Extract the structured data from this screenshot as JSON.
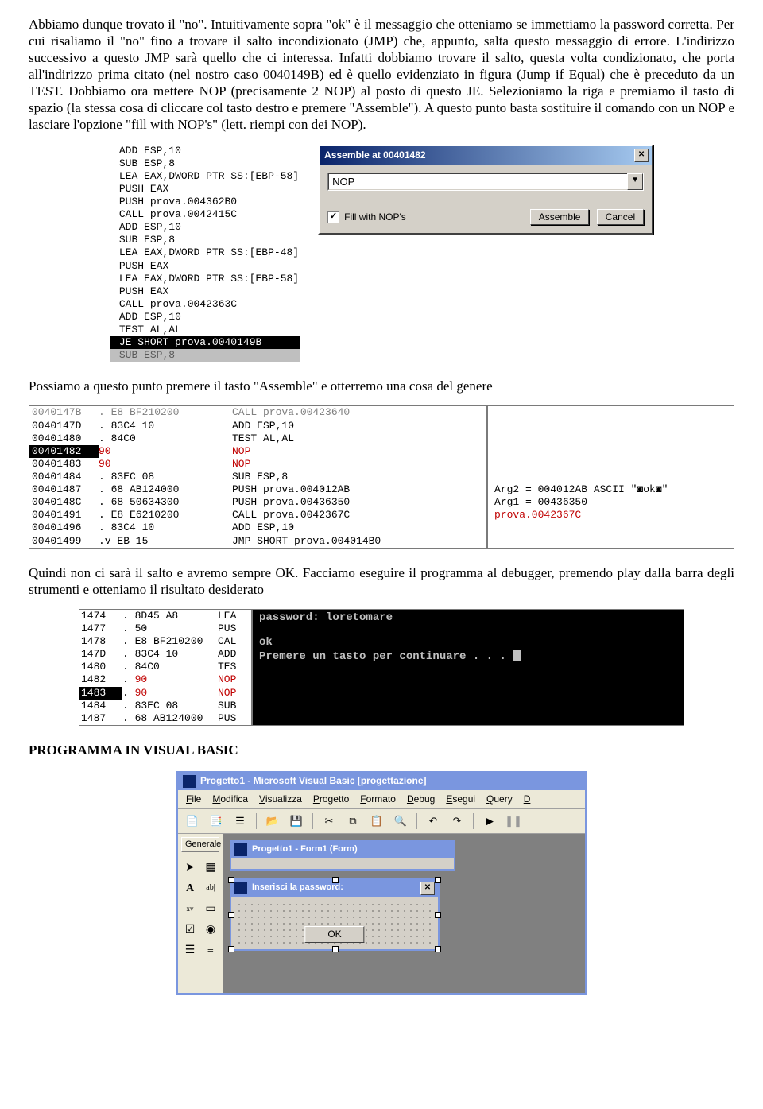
{
  "para1": "Abbiamo dunque trovato il \"no\". Intuitivamente sopra \"ok\" è il messaggio che otteniamo se immettiamo la password corretta. Per cui risaliamo il \"no\" fino a trovare il salto incondizionato (JMP) che, appunto, salta questo messaggio di errore. L'indirizzo successivo a questo JMP sarà quello che ci interessa. Infatti dobbiamo trovare il salto, questa volta condizionato, che porta all'indirizzo prima citato (nel nostro caso 0040149B) ed è quello evidenziato in figura (Jump if Equal) che è preceduto da un TEST. Dobbiamo ora mettere NOP (precisamente 2 NOP) al posto di questo JE. Selezioniamo la riga e premiamo il tasto di spazio (la stessa cosa di cliccare col tasto destro e premere \"Assemble\"). A questo punto basta sostituire il comando con un NOP e lasciare l'opzione \"fill with NOP's\" (lett. riempi con dei NOP).",
  "para2": "Possiamo a questo punto premere il tasto \"Assemble\" e otterremo una cosa del genere",
  "para3": "Quindi non ci sarà il salto e avremo sempre OK. Facciamo eseguire il programma al debugger, premendo play dalla barra degli strumenti e otteniamo il risultato desiderato",
  "heading": "PROGRAMMA IN VISUAL BASIC",
  "disasm1": [
    "ADD ESP,10",
    "SUB ESP,8",
    "LEA EAX,DWORD PTR SS:[EBP-58]",
    "PUSH EAX",
    "PUSH prova.004362B0",
    "CALL prova.0042415C",
    "ADD ESP,10",
    "SUB ESP,8",
    "LEA EAX,DWORD PTR SS:[EBP-48]",
    "PUSH EAX",
    "LEA EAX,DWORD PTR SS:[EBP-58]",
    "PUSH EAX",
    "CALL prova.0042363C",
    "ADD ESP,10",
    "TEST AL,AL"
  ],
  "disasm1_sel": "JE SHORT prova.0040149B",
  "disasm1_after": "SUB ESP,8",
  "assemble": {
    "title": "Assemble at 00401482",
    "value": "NOP",
    "checkbox": "Fill with NOP's",
    "btn1": "Assemble",
    "btn2": "Cancel"
  },
  "dbg2": [
    {
      "addr": "0040147D",
      "dot": ".",
      "hex": "83C4 10",
      "op": "ADD ESP,10"
    },
    {
      "addr": "00401480",
      "dot": ".",
      "hex": "84C0",
      "op": "TEST AL,AL"
    },
    {
      "addr": "00401482",
      "dot": "",
      "hex": "90",
      "op": "NOP",
      "hl": true,
      "red": true
    },
    {
      "addr": "00401483",
      "dot": "",
      "hex": "90",
      "op": "NOP",
      "red": true
    },
    {
      "addr": "00401484",
      "dot": ".",
      "hex": "83EC 08",
      "op": "SUB ESP,8"
    },
    {
      "addr": "00401487",
      "dot": ".",
      "hex": "68 AB124000",
      "op": "PUSH prova.004012AB"
    },
    {
      "addr": "0040148C",
      "dot": ".",
      "hex": "68 50634300",
      "op": "PUSH prova.00436350"
    },
    {
      "addr": "00401491",
      "dot": ".",
      "hex": "E8 E6210200",
      "op": "CALL prova.0042367C"
    },
    {
      "addr": "00401496",
      "dot": ".",
      "hex": "83C4 10",
      "op": "ADD ESP,10"
    },
    {
      "addr": "00401499",
      "dot": ".v",
      "hex": "EB 15",
      "op": "JMP SHORT prova.004014B0"
    }
  ],
  "dbg2_info": [
    "Arg2 = 004012AB ASCII \"◙ok◙\"",
    "Arg1 = 00436350",
    "prova.0042367C"
  ],
  "dbg3": [
    {
      "addr": "1474",
      "hex": "8D45 A8",
      "op": "LEA"
    },
    {
      "addr": "1477",
      "hex": "50",
      "op": "PUS"
    },
    {
      "addr": "1478",
      "hex": "E8 BF210200",
      "op": "CAL"
    },
    {
      "addr": "147D",
      "hex": "83C4 10",
      "op": "ADD"
    },
    {
      "addr": "1480",
      "hex": "84C0",
      "op": "TES"
    },
    {
      "addr": "1482",
      "hex": "90",
      "op": "NOP",
      "red": true
    },
    {
      "addr": "1483",
      "hex": "90",
      "op": "NOP",
      "red": true,
      "hl": true
    },
    {
      "addr": "1484",
      "hex": "83EC 08",
      "op": "SUB"
    },
    {
      "addr": "1487",
      "hex": "68 AB124000",
      "op": "PUS"
    }
  ],
  "console": {
    "l1": "password: loretomare",
    "l2": "ok",
    "l3": "Premere un tasto per continuare . . . "
  },
  "vb": {
    "title": "Progetto1 - Microsoft Visual Basic [progettazione]",
    "menu": [
      "File",
      "Modifica",
      "Visualizza",
      "Progetto",
      "Formato",
      "Debug",
      "Esegui",
      "Query",
      "D"
    ],
    "tooltab": "Generale",
    "form_title": "Progetto1 - Form1 (Form)",
    "dialog_title": "Inserisci la password:",
    "ok": "OK"
  }
}
